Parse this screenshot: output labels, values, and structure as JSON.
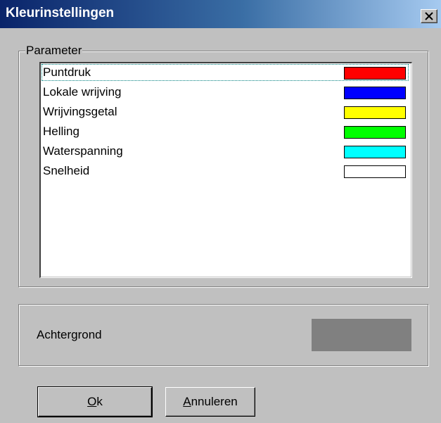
{
  "window": {
    "title": "Kleurinstellingen"
  },
  "parameter_group": {
    "label": "Parameter",
    "items": [
      {
        "label": "Puntdruk",
        "color": "#ff0000"
      },
      {
        "label": "Lokale wrijving",
        "color": "#0000ff"
      },
      {
        "label": "Wrijvingsgetal",
        "color": "#ffff00"
      },
      {
        "label": "Helling",
        "color": "#00ff00"
      },
      {
        "label": "Waterspanning",
        "color": "#00ffff"
      },
      {
        "label": "Snelheid",
        "color": "#ffffff"
      }
    ]
  },
  "background_group": {
    "label": "Achtergrond",
    "color": "#808080"
  },
  "buttons": {
    "ok": {
      "accel": "O",
      "rest": "k"
    },
    "cancel": {
      "accel": "A",
      "rest": "nnuleren"
    }
  }
}
